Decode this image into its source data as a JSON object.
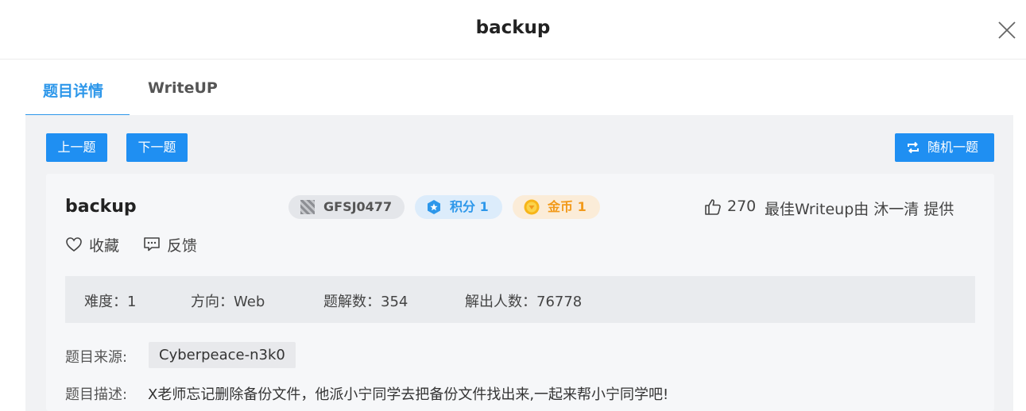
{
  "header": {
    "title": "backup"
  },
  "tabs": [
    {
      "label": "题目详情",
      "active": true
    },
    {
      "label": "WriteUP",
      "active": false
    }
  ],
  "nav": {
    "prev": "上一题",
    "next": "下一题",
    "random": "随机一题"
  },
  "challenge": {
    "title": "backup",
    "id_badge": "GFSJ0477",
    "score_badge": "积分 1",
    "gold_badge": "金币 1",
    "likes": "270",
    "best_writeup": "最佳Writeup由 沐一清 提供",
    "favorite": "收藏",
    "feedback": "反馈",
    "stats": {
      "difficulty": "难度：1",
      "direction": "方向：Web",
      "solves": "题解数：354",
      "solvers": "解出人数：76778"
    },
    "source_label": "题目来源:",
    "source_value": "Cyberpeace-n3k0",
    "desc_label": "题目描述:",
    "desc_value": "X老师忘记删除备份文件，他派小宁同学去把备份文件找出来,一起来帮小宁同学吧!"
  },
  "colors": {
    "accent": "#2d97ea",
    "button": "#1f8ff2",
    "gold": "#f29a1b"
  },
  "icons": [
    "close-icon",
    "shuffle-icon",
    "qr-icon",
    "score-icon",
    "gold-coin-icon",
    "thumbs-up-icon",
    "heart-icon",
    "comment-icon"
  ]
}
